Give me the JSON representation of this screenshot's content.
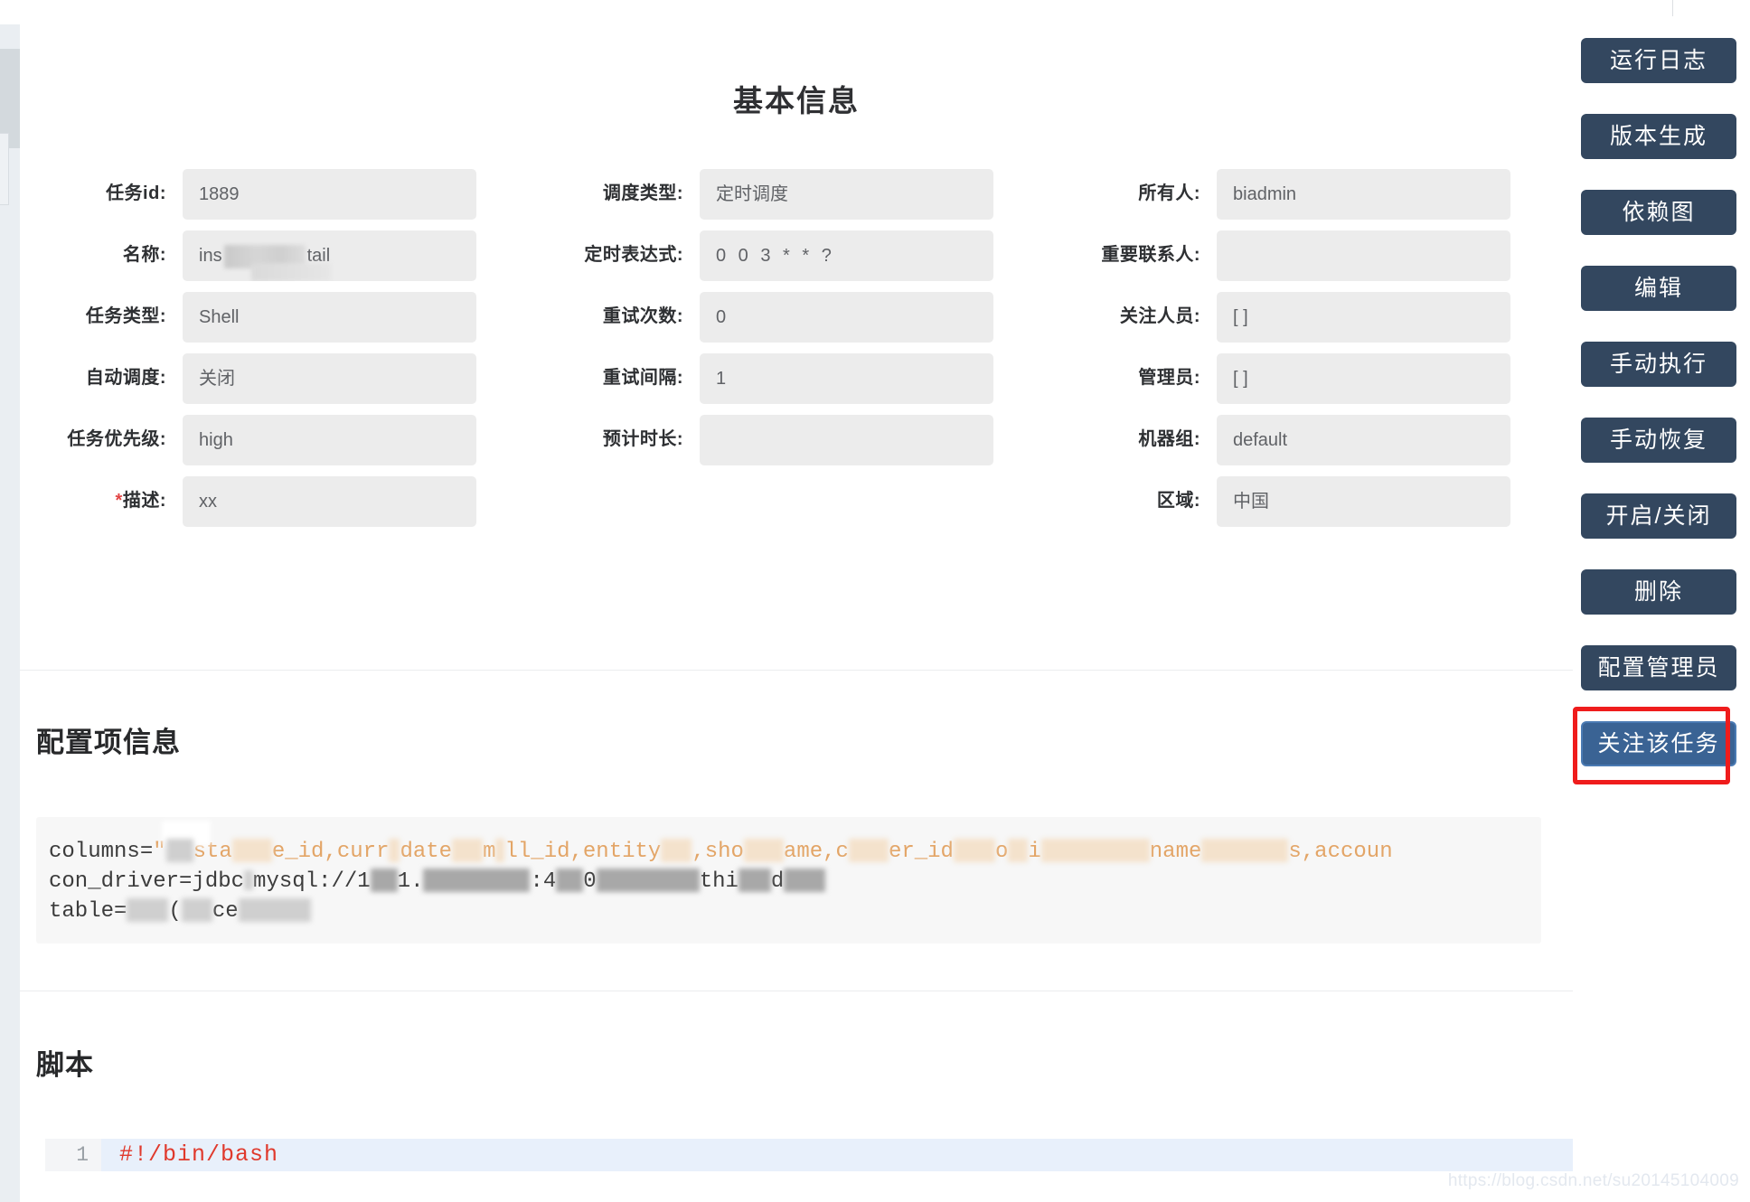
{
  "page": {
    "title": "基本信息",
    "watermark": "https://blog.csdn.net/su20145104009"
  },
  "basic_info": {
    "heading": "基本信息",
    "rows": [
      [
        {
          "label": "任务id:",
          "value": "1889",
          "required": false,
          "redacted": false
        },
        {
          "label": "调度类型:",
          "value": "定时调度",
          "required": false,
          "redacted": false
        },
        {
          "label": "所有人:",
          "value": "biadmin",
          "required": false,
          "redacted": false
        }
      ],
      [
        {
          "label": "名称:",
          "value": "ins          tail",
          "required": false,
          "redacted": true
        },
        {
          "label": "定时表达式:",
          "value": "0 0 3 * * ?",
          "required": false,
          "redacted": false
        },
        {
          "label": "重要联系人:",
          "value": "",
          "required": false,
          "redacted": false
        }
      ],
      [
        {
          "label": "任务类型:",
          "value": "Shell",
          "required": false,
          "redacted": false
        },
        {
          "label": "重试次数:",
          "value": "0",
          "required": false,
          "redacted": false
        },
        {
          "label": "关注人员:",
          "value": "[ ]",
          "required": false,
          "redacted": false
        }
      ],
      [
        {
          "label": "自动调度:",
          "value": "关闭",
          "required": false,
          "redacted": false
        },
        {
          "label": "重试间隔:",
          "value": "1",
          "required": false,
          "redacted": false
        },
        {
          "label": "管理员:",
          "value": "[ ]",
          "required": false,
          "redacted": false
        }
      ],
      [
        {
          "label": "任务优先级:",
          "value": "high",
          "required": false,
          "redacted": false
        },
        {
          "label": "预计时长:",
          "value": "",
          "required": false,
          "redacted": false
        },
        {
          "label": "机器组:",
          "value": "default",
          "required": false,
          "redacted": false
        }
      ],
      [
        {
          "label": "描述:",
          "value": "xx",
          "required": true,
          "redacted": false
        },
        {
          "label": "",
          "value": "",
          "required": false,
          "redacted": false,
          "empty": true
        },
        {
          "label": "区域:",
          "value": "中国",
          "required": false,
          "redacted": false
        }
      ]
    ]
  },
  "config_section": {
    "heading": "配置项信息",
    "code_lines": [
      "columns=\":  sta   e_id,curr date  m ll_id,entity   ,sho   ame,c  er_id   o   i        name       s,accoun",
      "con_driver=jdbc:mysql://1   1.        :4    0          thi    d",
      "table=      (   ce"
    ]
  },
  "script_section": {
    "heading": "脚本",
    "lines": [
      {
        "number": "1",
        "code": "#!/bin/bash"
      }
    ]
  },
  "sidebar": {
    "buttons": [
      {
        "label": "运行日志",
        "name": "run-log",
        "focused": false
      },
      {
        "label": "版本生成",
        "name": "version-generate",
        "focused": false
      },
      {
        "label": "依赖图",
        "name": "dependency-graph",
        "focused": false
      },
      {
        "label": "编辑",
        "name": "edit",
        "focused": false
      },
      {
        "label": "手动执行",
        "name": "manual-execute",
        "focused": false
      },
      {
        "label": "手动恢复",
        "name": "manual-recover",
        "focused": false
      },
      {
        "label": "开启/关闭",
        "name": "enable-disable",
        "focused": false
      },
      {
        "label": "删除",
        "name": "delete",
        "focused": false
      },
      {
        "label": "配置管理员",
        "name": "configure-admin",
        "focused": false
      },
      {
        "label": "关注该任务",
        "name": "follow-task",
        "focused": true
      }
    ]
  },
  "colors": {
    "button_bg": "#33475f",
    "button_focused_bg": "#3a6394",
    "highlight_ring": "#ef1c1c",
    "field_bg": "#ececec",
    "code_text": "#e3a567",
    "script_text": "#e0392c",
    "required_mark": "#e24545"
  }
}
